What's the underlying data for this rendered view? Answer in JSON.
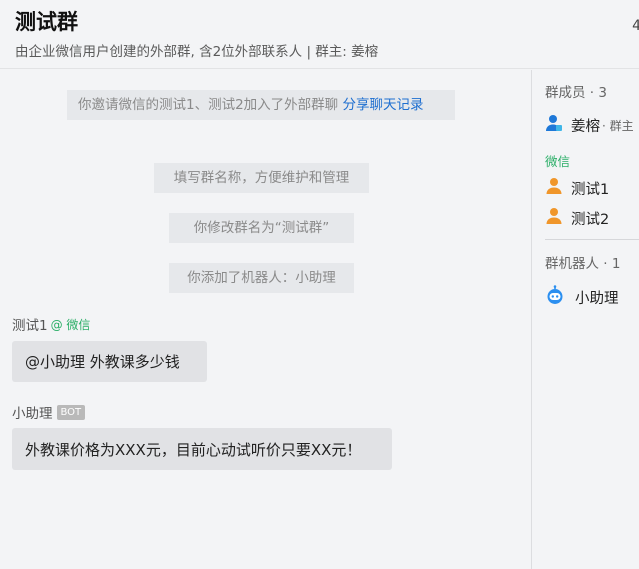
{
  "header": {
    "title": "测试群",
    "subtitle": "由企业微信用户创建的外部群, 含2位外部联系人  | 群主: 姜榕",
    "corner_mark": "4"
  },
  "chat": {
    "system_messages": [
      {
        "text": "你邀请微信的测试1、测试2加入了外部群聊",
        "link": "分享聊天记录"
      },
      {
        "text": "填写群名称，方便维护和管理"
      },
      {
        "text": "你修改群名为“测试群”"
      },
      {
        "text": "你添加了机器人：小助理"
      }
    ],
    "messages": [
      {
        "sender": "测试1",
        "sender_tag": "@ 微信",
        "text": "@小助理  外教课多少钱"
      },
      {
        "sender": "小助理",
        "sender_tag": "BOT",
        "text": "外教课价格为XXX元，目前心动试听价只要XX元！"
      }
    ]
  },
  "sidebar": {
    "members_heading": "群成员 · 3",
    "owner": {
      "name": "姜榕",
      "role": "· 群主",
      "icon": "person-icon",
      "color": "#1e78d8"
    },
    "wechat_label": "微信",
    "wechat_members": [
      {
        "name": "测试1",
        "icon": "person-icon",
        "color": "#f0962a"
      },
      {
        "name": "测试2",
        "icon": "person-icon",
        "color": "#f0962a"
      }
    ],
    "robots_heading": "群机器人 · 1",
    "robots": [
      {
        "name": "小助理",
        "icon": "robot-icon",
        "color": "#2b8ff0"
      }
    ]
  }
}
